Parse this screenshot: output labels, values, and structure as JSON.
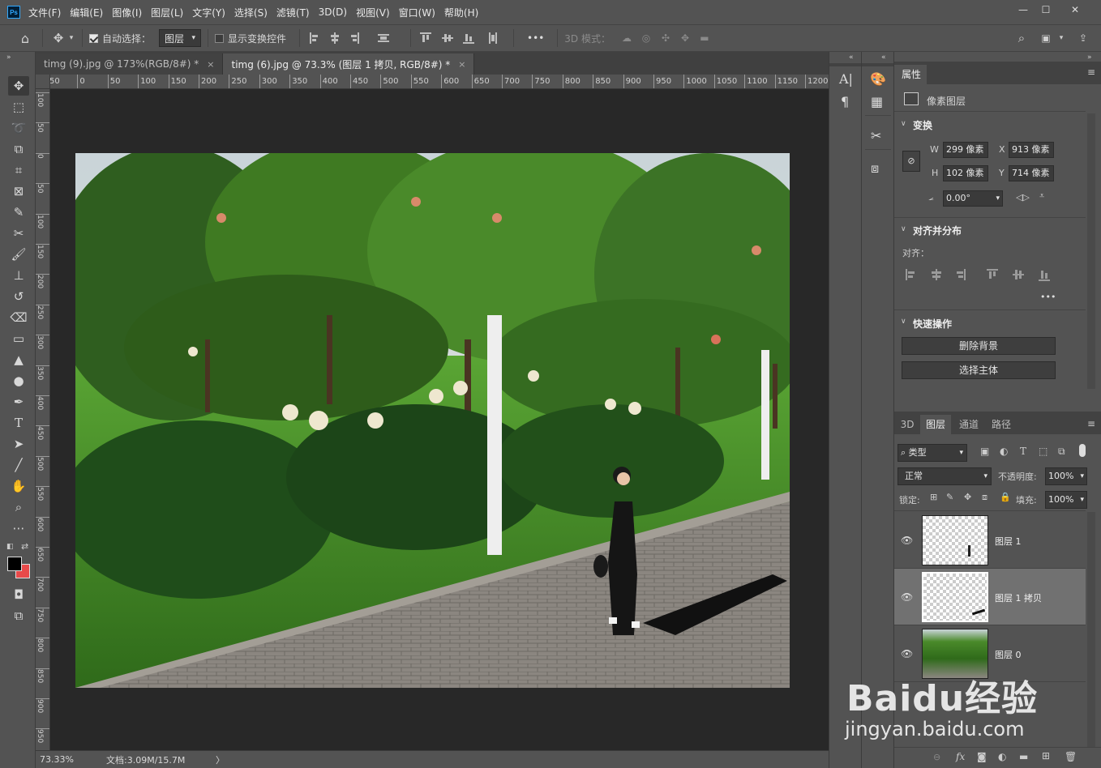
{
  "app": {
    "logo": "Ps"
  },
  "menu": [
    "文件(F)",
    "编辑(E)",
    "图像(I)",
    "图层(L)",
    "文字(Y)",
    "选择(S)",
    "滤镜(T)",
    "3D(D)",
    "视图(V)",
    "窗口(W)",
    "帮助(H)"
  ],
  "window_controls": {
    "minimize": "—",
    "maximize": "☐",
    "close": "✕"
  },
  "options": {
    "auto_select_label": "自动选择：",
    "auto_select_value": "图层",
    "show_transform_label": "显示变换控件",
    "more": "•••",
    "mode_3d_label": "3D 模式："
  },
  "tabs": [
    {
      "label": "timg (9).jpg @ 173%(RGB/8#) *",
      "close": "×"
    },
    {
      "label": "timg (6).jpg @ 73.3% (图层 1 拷贝, RGB/8#) *",
      "close": "×"
    }
  ],
  "ruler_top": [
    "50",
    "0",
    "50",
    "100",
    "150",
    "200",
    "250",
    "300",
    "350",
    "400",
    "450",
    "500",
    "550",
    "600",
    "650",
    "700",
    "750",
    "800",
    "850",
    "900",
    "950",
    "1000",
    "1050",
    "1100",
    "1150",
    "1200"
  ],
  "ruler_left": [
    "100",
    "50",
    "0",
    "50",
    "100",
    "150",
    "200",
    "250",
    "300",
    "350",
    "400",
    "450",
    "500",
    "550",
    "600",
    "650",
    "700",
    "750",
    "800",
    "850",
    "900",
    "950"
  ],
  "status": {
    "zoom": "73.33%",
    "doc": "文档:3.09M/15.7M",
    "arrow": "〉"
  },
  "properties": {
    "tab": "属性",
    "layer_type": "像素图层",
    "transform_title": "变换",
    "w_label": "W",
    "w_value": "299 像素",
    "x_label": "X",
    "x_value": "913 像素",
    "h_label": "H",
    "h_value": "102 像素",
    "y_label": "Y",
    "y_value": "714 像素",
    "angle_value": "0.00°",
    "align_title": "对齐并分布",
    "align_label": "对齐：",
    "more": "•••",
    "quick_title": "快速操作",
    "remove_bg": "删除背景",
    "select_subject": "选择主体"
  },
  "layers_panel": {
    "tabs": [
      "3D",
      "图层",
      "通道",
      "路径"
    ],
    "filter_label": "类型",
    "blend_mode": "正常",
    "opacity_label": "不透明度:",
    "opacity_value": "100%",
    "lock_label": "锁定:",
    "fill_label": "填充:",
    "fill_value": "100%",
    "layers": [
      {
        "name": "图层 1",
        "selected": false
      },
      {
        "name": "图层 1 拷贝",
        "selected": true
      },
      {
        "name": "图层 0",
        "selected": false
      }
    ]
  },
  "watermark": {
    "brand": "Baidu经验",
    "url": "jingyan.baidu.com"
  }
}
